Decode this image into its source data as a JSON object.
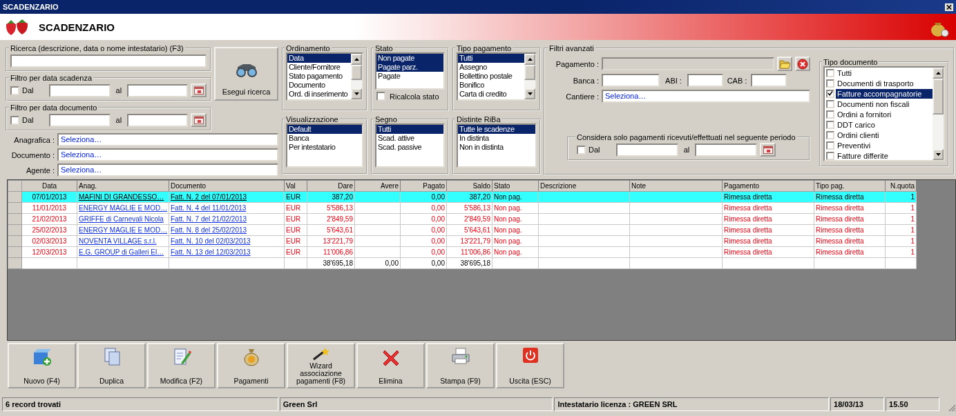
{
  "window": {
    "title": "SCADENZARIO"
  },
  "header": {
    "title": "SCADENZARIO"
  },
  "search": {
    "title": "Ricerca (descrizione, data o nome intestatario) (F3)"
  },
  "date_filters": [
    {
      "title": "Filtro per data scadenza",
      "checkbox_label": "Dal",
      "checked": false,
      "to_label": "al"
    },
    {
      "title": "Filtro per data documento",
      "checkbox_label": "Dal",
      "checked": false,
      "to_label": "al"
    }
  ],
  "search_button": {
    "label": "Esegui ricerca"
  },
  "selectors": [
    {
      "label": "Anagrafica :",
      "value": "Seleziona…"
    },
    {
      "label": "Documento :",
      "value": "Seleziona…"
    },
    {
      "label": "Agente :",
      "value": "Seleziona…"
    }
  ],
  "lists": [
    {
      "title": "Ordinamento",
      "items": [
        {
          "label": "Data",
          "selected": true
        },
        {
          "label": "Cliente/Fornitore",
          "selected": false
        },
        {
          "label": "Stato pagamento",
          "selected": false
        },
        {
          "label": "Documento",
          "selected": false
        },
        {
          "label": "Ord. di inserimento",
          "selected": false
        }
      ]
    },
    {
      "title": "Stato",
      "items": [
        {
          "label": "Non pagate",
          "selected": true
        },
        {
          "label": "Pagate parz.",
          "selected": true
        },
        {
          "label": "Pagate",
          "selected": false
        }
      ],
      "option": {
        "label": "Ricalcola stato",
        "checked": false
      }
    },
    {
      "title": "Tipo pagamento",
      "items": [
        {
          "label": "Tutti",
          "selected": true
        },
        {
          "label": "Assegno",
          "selected": false
        },
        {
          "label": "Bollettino postale",
          "selected": false
        },
        {
          "label": "Bonifico",
          "selected": false
        },
        {
          "label": "Carta di credito",
          "selected": false
        }
      ]
    },
    {
      "title": "Visualizzazione",
      "items": [
        {
          "label": "Default",
          "selected": true
        },
        {
          "label": "Banca",
          "selected": false
        },
        {
          "label": "Per intestatario",
          "selected": false
        }
      ]
    },
    {
      "title": "Segno",
      "items": [
        {
          "label": "Tutti",
          "selected": true
        },
        {
          "label": "Scad. attive",
          "selected": false
        },
        {
          "label": "Scad. passive",
          "selected": false
        }
      ]
    },
    {
      "title": "Distinte RiBa",
      "items": [
        {
          "label": "Tutte le scadenze",
          "selected": true
        },
        {
          "label": "In distinta",
          "selected": false
        },
        {
          "label": "Non in distinta",
          "selected": false
        }
      ]
    }
  ],
  "advanced_filters": {
    "title": "Filtri avanzati",
    "payment_label": "Pagamento :",
    "bank_label": "Banca :",
    "abi_label": "ABI :",
    "cab_label": "CAB :",
    "site_label": "Cantiere :",
    "site_value": "Seleziona…",
    "period": {
      "title": "Considera solo pagamenti ricevuti/effettuati nel seguente periodo",
      "checkbox_label": "Dal",
      "checked": false,
      "to_label": "al"
    }
  },
  "document_types": {
    "title": "Tipo documento",
    "items": [
      {
        "label": "Tutti",
        "checked": false,
        "selected": false
      },
      {
        "label": "Documenti di trasporto",
        "checked": false,
        "selected": false
      },
      {
        "label": "Fatture accompagnatorie",
        "checked": true,
        "selected": true
      },
      {
        "label": "Documenti non fiscali",
        "checked": false,
        "selected": false
      },
      {
        "label": "Ordini a fornitori",
        "checked": false,
        "selected": false
      },
      {
        "label": "DDT carico",
        "checked": false,
        "selected": false
      },
      {
        "label": "Ordini clienti",
        "checked": false,
        "selected": false
      },
      {
        "label": "Preventivi",
        "checked": false,
        "selected": false
      },
      {
        "label": "Fatture differite",
        "checked": false,
        "selected": false
      }
    ]
  },
  "table": {
    "columns": [
      {
        "label": "Data",
        "kind": "date"
      },
      {
        "label": "Anag.",
        "kind": "link"
      },
      {
        "label": "Documento",
        "kind": "link"
      },
      {
        "label": "Val",
        "kind": "text"
      },
      {
        "label": "Dare",
        "kind": "amount"
      },
      {
        "label": "Avere",
        "kind": "amount"
      },
      {
        "label": "Pagato",
        "kind": "amount"
      },
      {
        "label": "Saldo",
        "kind": "amount"
      },
      {
        "label": "Stato",
        "kind": "text"
      },
      {
        "label": "Descrizione",
        "kind": "text"
      },
      {
        "label": "Note",
        "kind": "text"
      },
      {
        "label": "Pagamento",
        "kind": "text"
      },
      {
        "label": "Tipo pag.",
        "kind": "text"
      },
      {
        "label": "N.quota",
        "kind": "amount"
      }
    ],
    "rows": [
      {
        "selected": true,
        "cells": [
          "07/01/2013",
          "MAFINI DI GRANDESSO…",
          "Fatt. N. 2 del 07/01/2013",
          "EUR",
          "387,20",
          null,
          "0,00",
          "387,20",
          "Non pag.",
          null,
          null,
          "Rimessa diretta",
          "Rimessa diretta",
          "1"
        ]
      },
      {
        "selected": false,
        "overdue": true,
        "cells": [
          "11/01/2013",
          "ENERGY MAGLIE E MOD…",
          "Fatt. N. 4 del 11/01/2013",
          "EUR",
          "5'586,13",
          null,
          "0,00",
          "5'586,13",
          "Non pag.",
          null,
          null,
          "Rimessa diretta",
          "Rimessa diretta",
          "1"
        ]
      },
      {
        "selected": false,
        "overdue": true,
        "cells": [
          "21/02/2013",
          "GRIFFE di Carnevali Nicola",
          "Fatt. N. 7 del 21/02/2013",
          "EUR",
          "2'849,59",
          null,
          "0,00",
          "2'849,59",
          "Non pag.",
          null,
          null,
          "Rimessa diretta",
          "Rimessa diretta",
          "1"
        ]
      },
      {
        "selected": false,
        "overdue": true,
        "cells": [
          "25/02/2013",
          "ENERGY MAGLIE E MOD…",
          "Fatt. N. 8 del 25/02/2013",
          "EUR",
          "5'643,61",
          null,
          "0,00",
          "5'643,61",
          "Non pag.",
          null,
          null,
          "Rimessa diretta",
          "Rimessa diretta",
          "1"
        ]
      },
      {
        "selected": false,
        "overdue": true,
        "cells": [
          "02/03/2013",
          "NOVENTA VILLAGE s.r.l.",
          "Fatt. N. 10 del 02/03/2013",
          "EUR",
          "13'221,79",
          null,
          "0,00",
          "13'221,79",
          "Non pag.",
          null,
          null,
          "Rimessa diretta",
          "Rimessa diretta",
          "1"
        ]
      },
      {
        "selected": false,
        "overdue": true,
        "cells": [
          "12/03/2013",
          "E.G. GROUP di Galleri El…",
          "Fatt. N. 13 del 12/03/2013",
          "EUR",
          "11'006,86",
          null,
          "0,00",
          "11'006,86",
          "Non pag.",
          null,
          null,
          "Rimessa diretta",
          "Rimessa diretta",
          "1"
        ]
      }
    ],
    "totals": {
      "dare": "38'695,18",
      "avere": "0,00",
      "pagato": "0,00",
      "saldo": "38'695,18"
    }
  },
  "toolbar": [
    {
      "label": "Nuovo (F4)",
      "kind": "new"
    },
    {
      "label": "Duplica",
      "kind": "duplicate"
    },
    {
      "label": "Modifica (F2)",
      "kind": "edit"
    },
    {
      "label": "Pagamenti",
      "kind": "payments"
    },
    {
      "label": "Wizard associazione pagamenti (F8)",
      "kind": "wizard"
    },
    {
      "label": "Elimina",
      "kind": "delete"
    },
    {
      "label": "Stampa (F9)",
      "kind": "print"
    },
    {
      "label": "Uscita (ESC)",
      "kind": "exit"
    }
  ],
  "status_bar": [
    "6 record trovati",
    "Green Srl",
    "Intestatario licenza : GREEN SRL",
    "18/03/13",
    "15.50"
  ]
}
